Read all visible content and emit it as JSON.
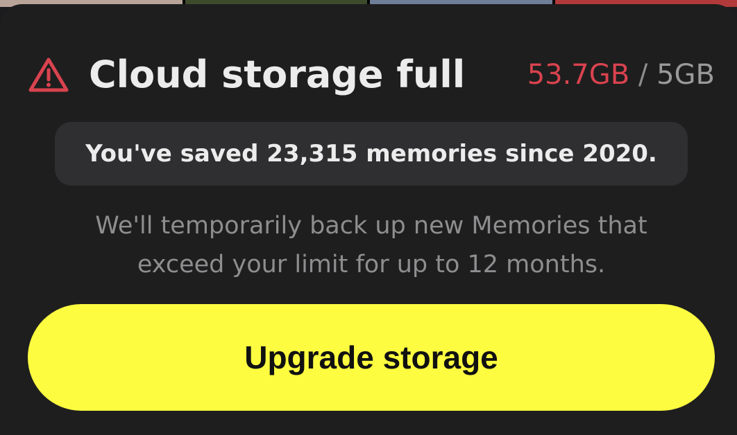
{
  "header": {
    "icon": "warning-triangle-icon",
    "title": "Cloud storage full",
    "usage_used": "53.7GB",
    "usage_separator": "/",
    "usage_limit": "5GB"
  },
  "summary": {
    "text": "You've saved 23,315 memories since 2020."
  },
  "description": {
    "line1": "We'll temporarily back up new Memories that",
    "line2": "exceed your limit for up to 12 months."
  },
  "cta": {
    "label": "Upgrade storage"
  },
  "colors": {
    "accent_yellow": "#fdfc40",
    "warning_red": "#d9434f",
    "background": "#1e1e1e"
  }
}
